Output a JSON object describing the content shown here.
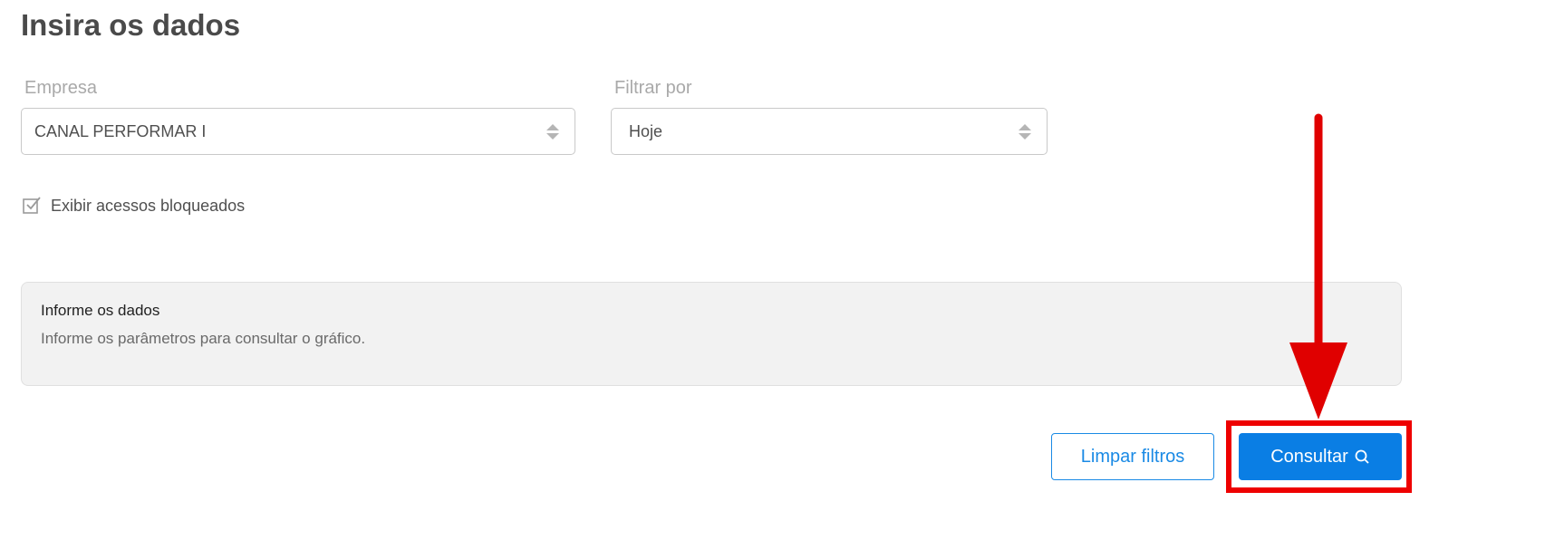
{
  "title": "Insira os dados",
  "form": {
    "company": {
      "label": "Empresa",
      "value": "CANAL PERFORMAR I"
    },
    "filter": {
      "label": "Filtrar por",
      "value": "Hoje"
    },
    "show_blocked": {
      "label": "Exibir acessos bloqueados",
      "checked": true
    }
  },
  "info": {
    "title": "Informe os dados",
    "message": "Informe os parâmetros para consultar o gráfico."
  },
  "actions": {
    "clear_label": "Limpar filtros",
    "submit_label": "Consultar",
    "submit_icon": "search-icon"
  },
  "colors": {
    "primary": "#0a7ee4",
    "annotation": "#ee0000"
  }
}
